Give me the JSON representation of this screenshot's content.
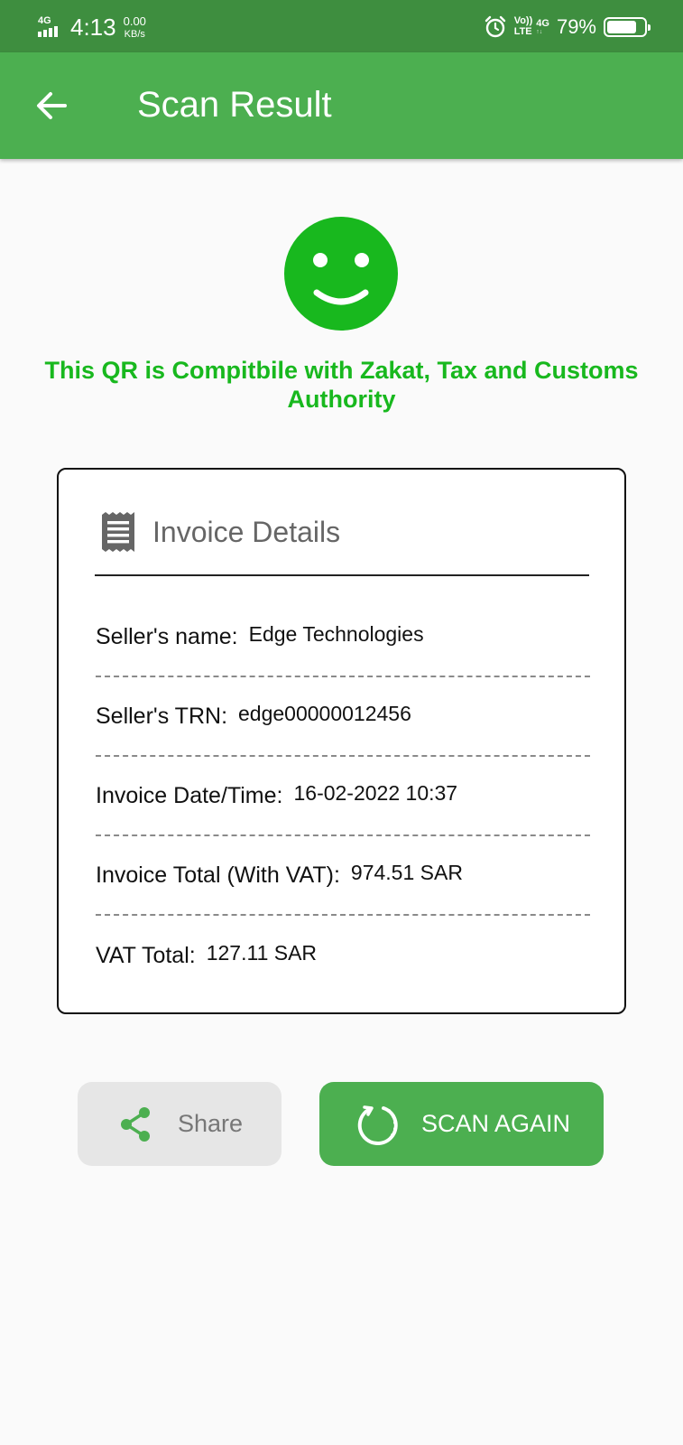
{
  "status_bar": {
    "network": "4G",
    "time": "4:13",
    "speed_value": "0.00",
    "speed_unit": "KB/s",
    "volte_top": "Vo))",
    "volte_bottom": "LTE",
    "network2": "4G",
    "battery_percent": "79%",
    "battery_level": 0.79
  },
  "app_bar": {
    "title": "Scan Result",
    "back_icon": "arrow-left-icon"
  },
  "result": {
    "icon": "smiley-icon",
    "message": "This QR is Compitbile with Zakat, Tax and Customs Authority",
    "color": "#18b81e"
  },
  "invoice": {
    "icon": "receipt-icon",
    "title": "Invoice Details",
    "rows": [
      {
        "label": "Seller's name:",
        "value": "Edge Technologies"
      },
      {
        "label": "Seller's TRN:",
        "value": "edge00000012456"
      },
      {
        "label": "Invoice Date/Time:",
        "value": "16-02-2022 10:37"
      },
      {
        "label": "Invoice Total (With VAT):",
        "value": "974.51 SAR"
      },
      {
        "label": "VAT Total:",
        "value": "127.11 SAR"
      }
    ]
  },
  "actions": {
    "share_label": "Share",
    "share_icon": "share-icon",
    "scan_again_label": "SCAN AGAIN",
    "scan_again_icon": "refresh-icon"
  },
  "colors": {
    "status_bar": "#3e8e3f",
    "primary": "#4caf50",
    "background": "#fafafa"
  }
}
